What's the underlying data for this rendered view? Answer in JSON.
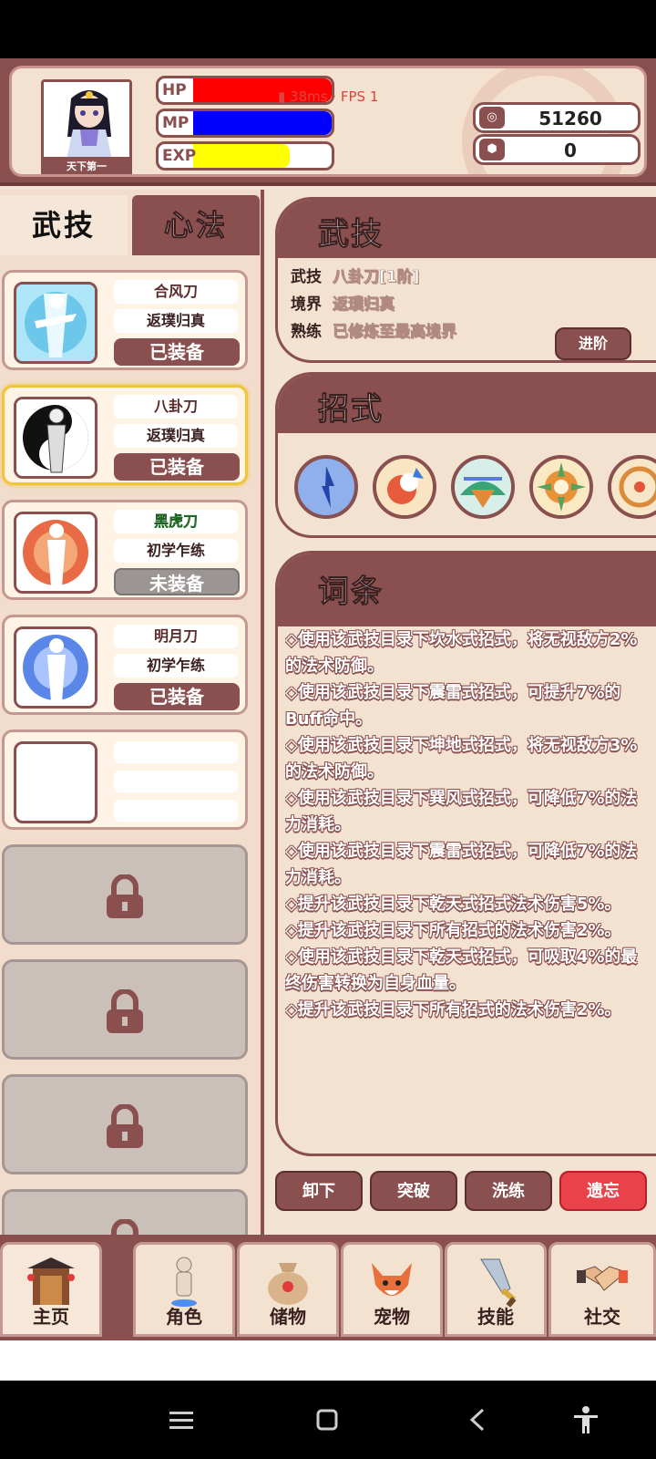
{
  "header": {
    "avatar_caption": "天下第一",
    "hp_label": "HP",
    "mp_label": "MP",
    "exp_label": "EXP",
    "hp_fraction": 1.0,
    "mp_fraction": 1.0,
    "exp_fraction": 0.7,
    "net_overlay": "38ms · FPS 1",
    "currency_coins": "51260",
    "currency_gems": "0",
    "colors": {
      "hp": "#ff0000",
      "mp": "#0000ff",
      "exp": "#ffff00"
    }
  },
  "left_tabs": {
    "active": "武技",
    "inactive": "心法"
  },
  "skills": [
    {
      "name": "合风刀",
      "realm": "返璞归真",
      "status": "已装备",
      "equipped": true
    },
    {
      "name": "八卦刀",
      "realm": "返璞归真",
      "status": "已装备",
      "equipped": true
    },
    {
      "name": "黑虎刀",
      "realm": "初学乍练",
      "status": "未装备",
      "equipped": false
    },
    {
      "name": "明月刀",
      "realm": "初学乍练",
      "status": "已装备",
      "equipped": true
    }
  ],
  "detail": {
    "title": "武技",
    "row1_key": "武技",
    "row1_val": "八卦刀[1阶]",
    "row2_key": "境界",
    "row2_val": "返璞归真",
    "row3_key": "熟练",
    "row3_val": "已修炼至最高境界",
    "advance_button": "进阶"
  },
  "moves": {
    "title": "招式"
  },
  "entries": {
    "title": "词条",
    "items": [
      "◇使用该武技目录下坎水式招式，将无视敌方2%的法术防御。",
      "◇使用该武技目录下震雷式招式，可提升7%的Buff命中。",
      "◇使用该武技目录下坤地式招式，将无视敌方3%的法术防御。",
      "◇使用该武技目录下巽风式招式，可降低7%的法力消耗。",
      "◇使用该武技目录下震雷式招式，可降低7%的法力消耗。",
      "◇提升该武技目录下乾天式招式法术伤害5%。",
      "◇提升该武技目录下所有招式的法术伤害2%。",
      "◇使用该武技目录下乾天式招式，可吸取4%的最终伤害转换为自身血量。",
      "◇提升该武技目录下所有招式的法术伤害2%。"
    ]
  },
  "actions": {
    "unload": "卸下",
    "breakthrough": "突破",
    "refine": "洗练",
    "forget": "遗忘"
  },
  "nav": [
    {
      "label": "主页",
      "icon": "gate-icon"
    },
    {
      "label": "角色",
      "icon": "character-icon"
    },
    {
      "label": "储物",
      "icon": "bag-icon"
    },
    {
      "label": "宠物",
      "icon": "fox-icon"
    },
    {
      "label": "技能",
      "icon": "sword-icon"
    },
    {
      "label": "社交",
      "icon": "handshake-icon"
    }
  ]
}
